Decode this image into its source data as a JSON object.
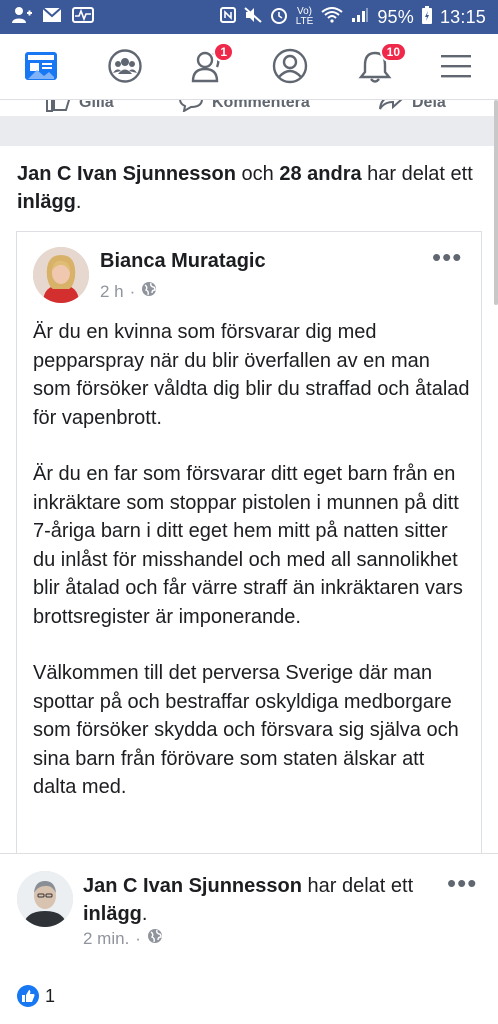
{
  "status_bar": {
    "battery_percent": "95%",
    "time": "13:15",
    "network_label": "LTE",
    "icons": [
      "person-add-icon",
      "mail-icon",
      "activity-icon",
      "nfc-icon",
      "mute-icon",
      "alarm-icon",
      "lte-icon",
      "wifi-icon",
      "signal-icon",
      "battery-icon"
    ]
  },
  "nav": {
    "tabs": [
      "news-feed-icon",
      "groups-icon",
      "friend-requests-icon",
      "profile-icon",
      "notifications-icon",
      "menu-icon"
    ],
    "friend_requests_badge": "1",
    "notifications_badge": "10",
    "accent_color": "#1877f2"
  },
  "previous_post_actions": {
    "like": "Gilla",
    "comment": "Kommentera",
    "share": "Dela"
  },
  "share_header": {
    "name": "Jan C Ivan Sjunnesson",
    "conj": "och",
    "others": "28 andra",
    "verb": "har delat ett",
    "object": "inlägg",
    "end": "."
  },
  "post": {
    "author": "Bianca Muratagic",
    "time": "2 h",
    "privacy_icon": "globe-icon",
    "paragraphs": [
      "Är du en kvinna som försvarar dig med pepparspray när du blir överfallen av en man som försöker våldta dig blir du straffad och åtalad för vapenbrott.",
      "Är du en far som försvarar ditt eget barn från en inkräktare som stoppar pistolen i munnen på ditt 7-åriga barn i ditt eget hem mitt på natten sitter du inlåst för misshandel och med all sannolikhet blir åtalad och får värre straff än inkräktaren vars brottsregister är imponerande.",
      "Välkommen till det perversa Sverige där man spottar på och bestraffar oskyldiga medborgare som försöker skydda och försvara sig själva och sina barn från förövare som staten älskar att dalta med."
    ]
  },
  "share2": {
    "name": "Jan C Ivan Sjunnesson",
    "verb": "har delat ett",
    "object": "inlägg",
    "end": ".",
    "time": "2 min.",
    "privacy_icon": "globe-icon"
  },
  "reactions": {
    "count": "1",
    "icon": "like-icon"
  }
}
